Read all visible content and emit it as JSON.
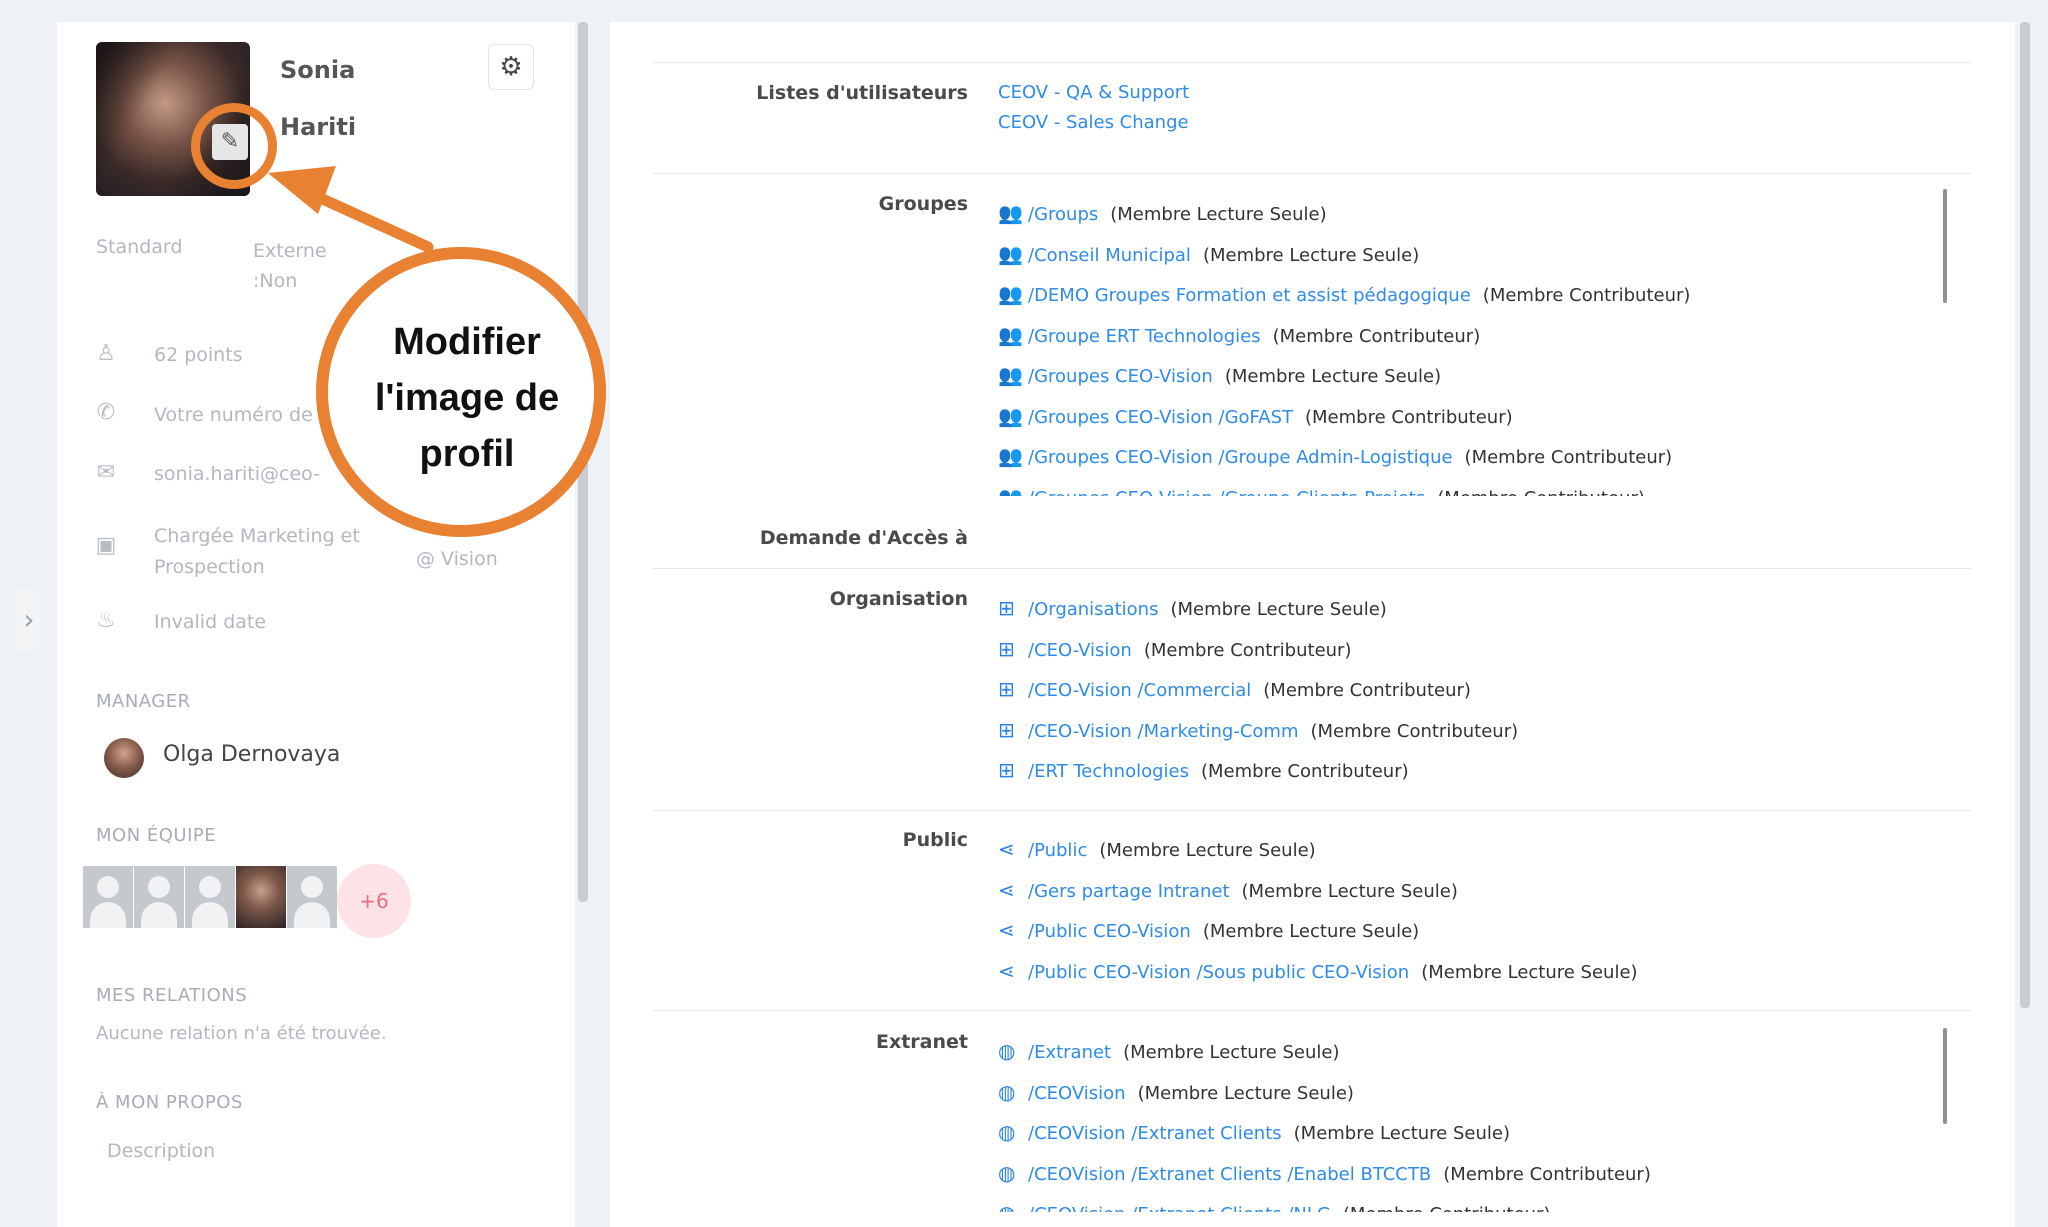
{
  "profile": {
    "first_name": "Sonia",
    "last_name": "Hariti",
    "type": "Standard",
    "external": "Externe\n:Non",
    "points": "62 points",
    "phone": "Votre numéro de",
    "email": "sonia.hariti@ceo-",
    "job": "Chargée Marketing et\nProspection",
    "company": "@ Vision",
    "birthdate": "Invalid date"
  },
  "icons": {
    "edit": "pencil-icon",
    "settings": "gear-icon",
    "points": "award-icon",
    "phone": "phone-icon",
    "email": "envelope-icon",
    "job": "briefcase-icon",
    "birthday": "cake-icon",
    "collapse": "chevron-right-icon"
  },
  "sections": {
    "manager_title": "MANAGER",
    "manager_name": "Olga Dernovaya",
    "team_title": "MON ÉQUIPE",
    "team_more": "+6",
    "relations_title": "MES RELATIONS",
    "relations_empty": "Aucune relation n'a été trouvée.",
    "about_title": "À MON PROPOS",
    "about_placeholder": "Description"
  },
  "callout": {
    "text": "Modifier\nl'image de\nprofil",
    "color": "#e98132"
  },
  "right": {
    "lists_label": "Listes d'utilisateurs",
    "lists": [
      "CEOV - QA & Support",
      "CEOV - Sales Change"
    ],
    "groups_label": "Groupes",
    "groups": [
      {
        "path": "/Groups",
        "role": "(Membre Lecture Seule)"
      },
      {
        "path": "/Conseil Municipal",
        "role": "(Membre Lecture Seule)"
      },
      {
        "path": "/DEMO Groupes Formation et assist pédagogique",
        "role": "(Membre Contributeur)"
      },
      {
        "path": "/Groupe ERT Technologies",
        "role": "(Membre Contributeur)"
      },
      {
        "path": "/Groupes CEO-Vision",
        "role": "(Membre Lecture Seule)"
      },
      {
        "path": "/Groupes CEO-Vision /GoFAST",
        "role": "(Membre Contributeur)"
      },
      {
        "path": "/Groupes CEO-Vision /Groupe Admin-Logistique",
        "role": "(Membre Contributeur)"
      },
      {
        "path": "/Groupes CEO-Vision /Groupe Clients-Projets",
        "role": "(Membre Contributeur)"
      }
    ],
    "access_label": "Demande d'Accès à",
    "org_label": "Organisation",
    "organisations": [
      {
        "path": "/Organisations",
        "role": "(Membre Lecture Seule)"
      },
      {
        "path": "/CEO-Vision",
        "role": "(Membre Contributeur)"
      },
      {
        "path": "/CEO-Vision /Commercial",
        "role": "(Membre Contributeur)"
      },
      {
        "path": "/CEO-Vision /Marketing-Comm",
        "role": "(Membre Contributeur)"
      },
      {
        "path": "/ERT Technologies",
        "role": "(Membre Contributeur)"
      }
    ],
    "public_label": "Public",
    "publics": [
      {
        "path": "/Public",
        "role": "(Membre Lecture Seule)"
      },
      {
        "path": "/Gers partage Intranet",
        "role": "(Membre Lecture Seule)"
      },
      {
        "path": "/Public CEO-Vision",
        "role": "(Membre Lecture Seule)"
      },
      {
        "path": "/Public CEO-Vision /Sous public CEO-Vision",
        "role": "(Membre Lecture Seule)"
      }
    ],
    "extranet_label": "Extranet",
    "extranets": [
      {
        "path": "/Extranet",
        "role": "(Membre Lecture Seule)"
      },
      {
        "path": "/CEOVision",
        "role": "(Membre Lecture Seule)"
      },
      {
        "path": "/CEOVision /Extranet Clients",
        "role": "(Membre Lecture Seule)"
      },
      {
        "path": "/CEOVision /Extranet Clients /Enabel BTCCTB",
        "role": "(Membre Contributeur)"
      },
      {
        "path": "/CEOVision /Extranet Clients /NLG",
        "role": "(Membre Contributeur)"
      }
    ],
    "row_icons": {
      "groups": "users-icon",
      "organisations": "sitemap-icon",
      "publics": "share-icon",
      "extranets": "globe-icon"
    }
  }
}
